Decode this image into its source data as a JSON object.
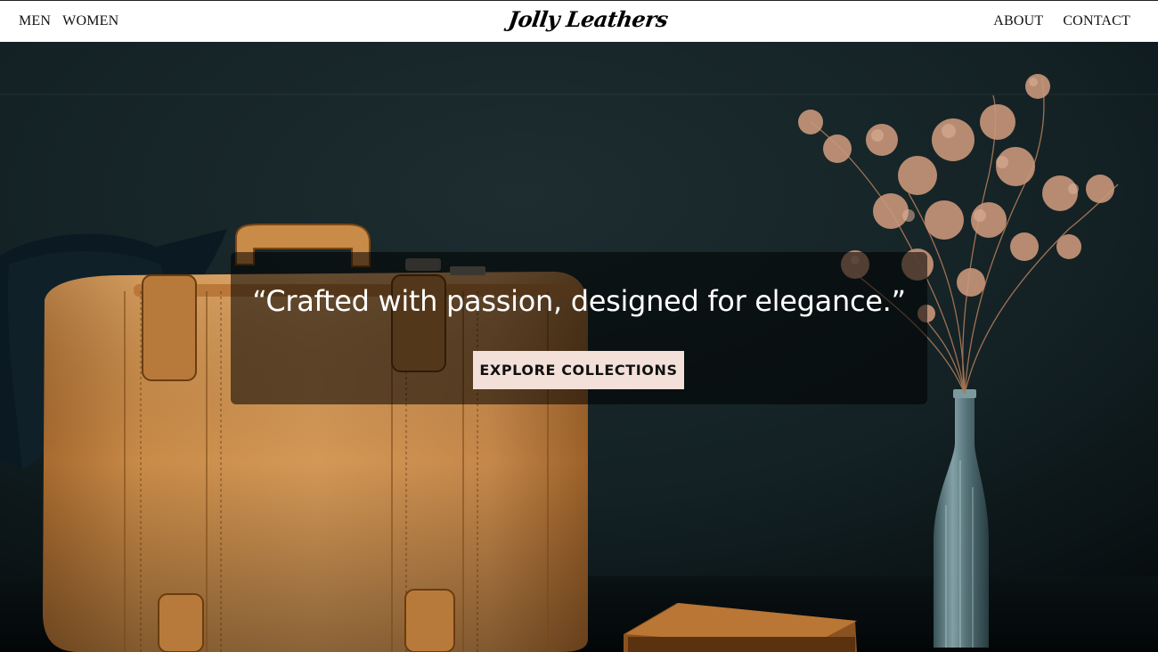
{
  "nav": {
    "left": [
      "MEN",
      "WOMEN"
    ],
    "brand": "Jolly Leathers",
    "right": [
      "ABOUT",
      "CONTACT"
    ]
  },
  "hero": {
    "tagline": "“Crafted with passion, designed for elegance.”",
    "cta_label": "EXPLORE COLLECTIONS"
  },
  "colors": {
    "nav_bg": "#ffffff",
    "hero_bg": "#0d1618",
    "cta_bg": "#f3e0d8",
    "leather": "#c98b48"
  }
}
